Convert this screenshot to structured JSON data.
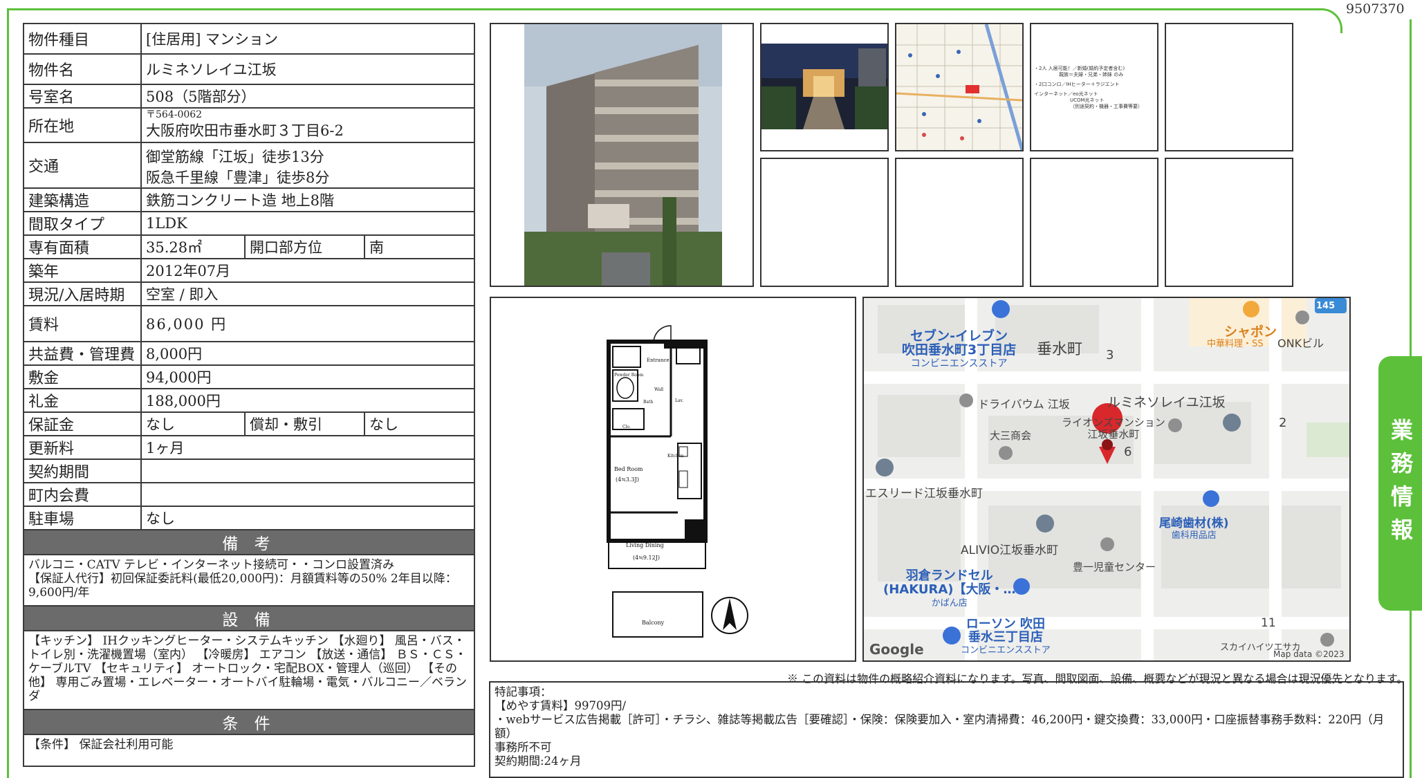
{
  "property_id": "9507370",
  "details": {
    "type_label": "物件種目",
    "type_value": "[住居用] マンション",
    "name_label": "物件名",
    "name_value": "ルミネソレイユ江坂",
    "room_label": "号室名",
    "room_value": "508（5階部分）",
    "address_label": "所在地",
    "postal": "〒564-0062",
    "address": "大阪府吹田市垂水町３丁目6-2",
    "access_label": "交通",
    "access_1": "御堂筋線「江坂」徒歩13分",
    "access_2": "阪急千里線「豊津」徒歩8分",
    "structure_label": "建築構造",
    "structure_value": "鉄筋コンクリート造 地上8階",
    "layout_label": "間取タイプ",
    "layout_value": "1LDK",
    "area_label": "専有面積",
    "area_value": "35.28㎡",
    "direction_label": "開口部方位",
    "direction_value": "南",
    "built_label": "築年",
    "built_value": "2012年07月",
    "status_label": "現況/入居時期",
    "status_value": "空室 / 即入",
    "rent_label": "賃料",
    "rent_value": "86,000 円",
    "fee_label": "共益費・管理費",
    "fee_value": "8,000円",
    "deposit_label": "敷金",
    "deposit_value": "94,000円",
    "keymoney_label": "礼金",
    "keymoney_value": "188,000円",
    "guarantee_label": "保証金",
    "guarantee_value": "なし",
    "amort_label": "償却・敷引",
    "amort_value": "なし",
    "renewal_label": "更新料",
    "renewal_value": "1ヶ月",
    "contract_label": "契約期間",
    "contract_value": "",
    "community_label": "町内会費",
    "community_value": "",
    "parking_label": "駐車場",
    "parking_value": "なし"
  },
  "sections": {
    "biko_title": "備 考",
    "biko_1": "バルコニ・CATV テレビ・インターネット接続可・・コンロ設置済み",
    "biko_2": "【保証人代行】初回保証委託料(最低20,000円)：月額賃料等の50% 2年目以降：9,600円/年",
    "setsubi_title": "設 備",
    "setsubi_text": "【キッチン】 IHクッキングヒーター・システムキッチン 【水廻り】 風呂・バス・トイレ別・洗濯機置場（室内） 【冷暖房】 エアコン 【放送・通信】 ＢＳ・ＣＳ・ケーブルTV 【セキュリティ】 オートロック・宅配BOX・管理人（巡回） 【その他】 専用ごみ置場・エレベーター・オートバイ駐輪場・電気・バルコニー／ベランダ",
    "joken_title": "条 件",
    "joken_text": "【条件】 保証会社利用可能"
  },
  "images": {
    "flyer_lines": [
      "・2人 入居可能！／新婚(婚約予定者含む)",
      "親族＝夫婦・兄弟・姉妹 のみ",
      "・2口コンロ／IHヒーター＋ラジエント",
      "インターネット／eo光ネット",
      "UCOM光ネット",
      "（別途契約・機器・工事費等要）"
    ],
    "floor_labels": [
      "Entrance",
      "Powder Room",
      "Bath",
      "Wall",
      "Lav.",
      "Clo.",
      "Kitchen",
      "Bed Room",
      "(4≒3.3J)",
      "Living Dining",
      "(4≒9.12J)",
      "Balcony"
    ]
  },
  "map": {
    "store1_line1": "セブン-イレブン",
    "store1_line2": "吹田垂水町3丁目店",
    "store1_line3": "コンビニエンスストア",
    "district": "垂水町",
    "num3": "3",
    "num2": "2",
    "num6": "6",
    "num11": "11",
    "road_num": "145",
    "restaurant": "シャポン",
    "restaurant_type": "中華料理・SS",
    "onk": "ONKビル",
    "dry": "ドライバウム 江坂",
    "target": "ルミネソレイユ江坂",
    "lions_1": "ライオンズマンション",
    "lions_2": "江坂垂水町",
    "daisan": "大三商会",
    "esreed": "エスリード江坂垂水町",
    "alivio": "ALIVIO江坂垂水町",
    "ozaki_1": "尾崎歯材(株)",
    "ozaki_2": "歯科用品店",
    "toyo": "豊一児童センター",
    "hakura_1": "羽倉ランドセル",
    "hakura_2": "(HAKURA)【大阪・…",
    "hakura_3": "かばん店",
    "lawson_1": "ローソン 吹田",
    "lawson_2": "垂水三丁目店",
    "lawson_3": "コンビニエンスストア",
    "sky": "スカイハイツエサカ",
    "google": "Google",
    "mapdata": "Map data ©2023"
  },
  "note": "※ この資料は物件の概略紹介資料になります。写真、間取図面、設備、概要などが現況と異なる場合は現況優先となります。",
  "remarks": {
    "title": "特記事項：",
    "line1": "【めやす賃料】99709円/",
    "line2": "・webサービス広告掲載［許可］・チラシ、雑誌等掲載広告［要確認］・保険：保険要加入・室内清掃費：46,200円・鍵交換費：33,000円・口座振替事務手数料：220円（月額）",
    "line3": "事務所不可",
    "line4": "契約期間:24ヶ月"
  },
  "side_tab": "業務情報"
}
